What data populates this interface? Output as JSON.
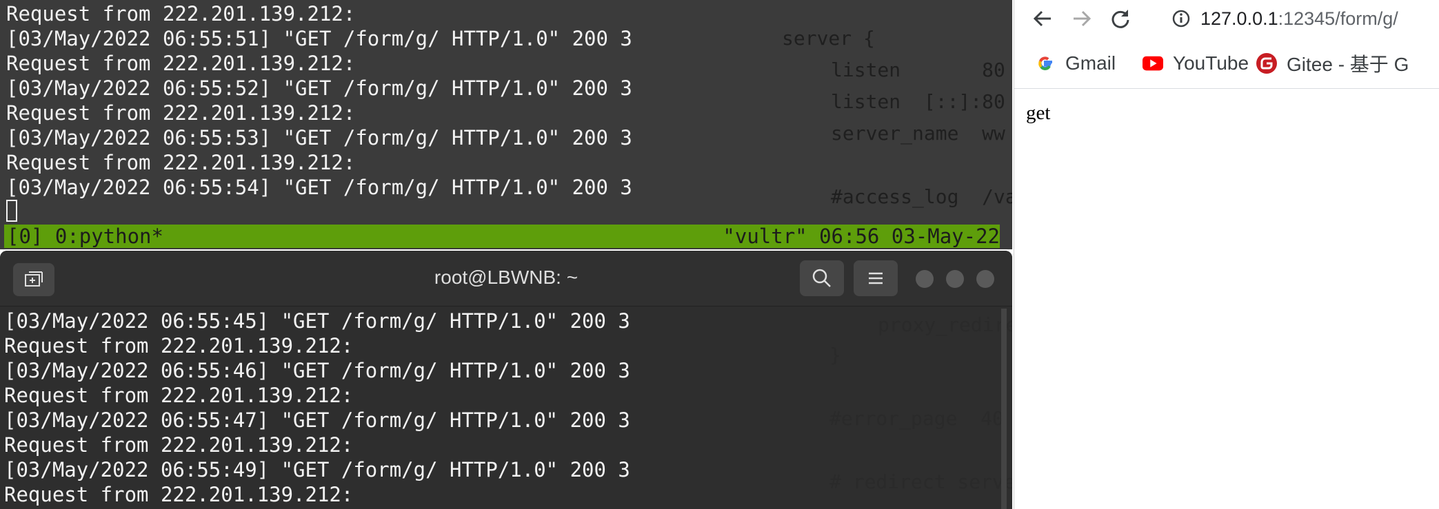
{
  "top_terminal": {
    "lines": [
      "Request from 222.201.139.212:",
      "[03/May/2022 06:55:51] \"GET /form/g/ HTTP/1.0\" 200 3",
      "Request from 222.201.139.212:",
      "[03/May/2022 06:55:52] \"GET /form/g/ HTTP/1.0\" 200 3",
      "Request from 222.201.139.212:",
      "[03/May/2022 06:55:53] \"GET /form/g/ HTTP/1.0\" 200 3",
      "Request from 222.201.139.212:",
      "[03/May/2022 06:55:54] \"GET /form/g/ HTTP/1.0\" 200 3"
    ],
    "tmux_status_left": "[0] 0:python*",
    "tmux_status_right": "\"vultr\" 06:56 03-May-22"
  },
  "editor": {
    "lines": [
      "server {",
      "listen       80",
      "listen  [::]:80",
      "server_name  ww",
      "#access_log  /va",
      "proxy_redire",
      "}",
      "#error_page  40",
      "# redirect serve"
    ]
  },
  "bottom_terminal": {
    "title": "root@LBWNB: ~",
    "lines": [
      "[03/May/2022 06:55:45] \"GET /form/g/ HTTP/1.0\" 200 3",
      "Request from 222.201.139.212:",
      "[03/May/2022 06:55:46] \"GET /form/g/ HTTP/1.0\" 200 3",
      "Request from 222.201.139.212:",
      "[03/May/2022 06:55:47] \"GET /form/g/ HTTP/1.0\" 200 3",
      "Request from 222.201.139.212:",
      "[03/May/2022 06:55:49] \"GET /form/g/ HTTP/1.0\" 200 3",
      "Request from 222.201.139.212:"
    ]
  },
  "browser": {
    "url_host": "127.0.0.1",
    "url_path": ":12345/form/g/",
    "bookmarks": [
      "Gmail",
      "YouTube",
      "Gitee - 基于 G"
    ],
    "page_text": "get"
  },
  "colors": {
    "terminal_bg": "#3b3b3b",
    "tmux_bar": "#5e9e0b",
    "youtube_red": "#ff0000",
    "gitee_red": "#c71d23"
  }
}
